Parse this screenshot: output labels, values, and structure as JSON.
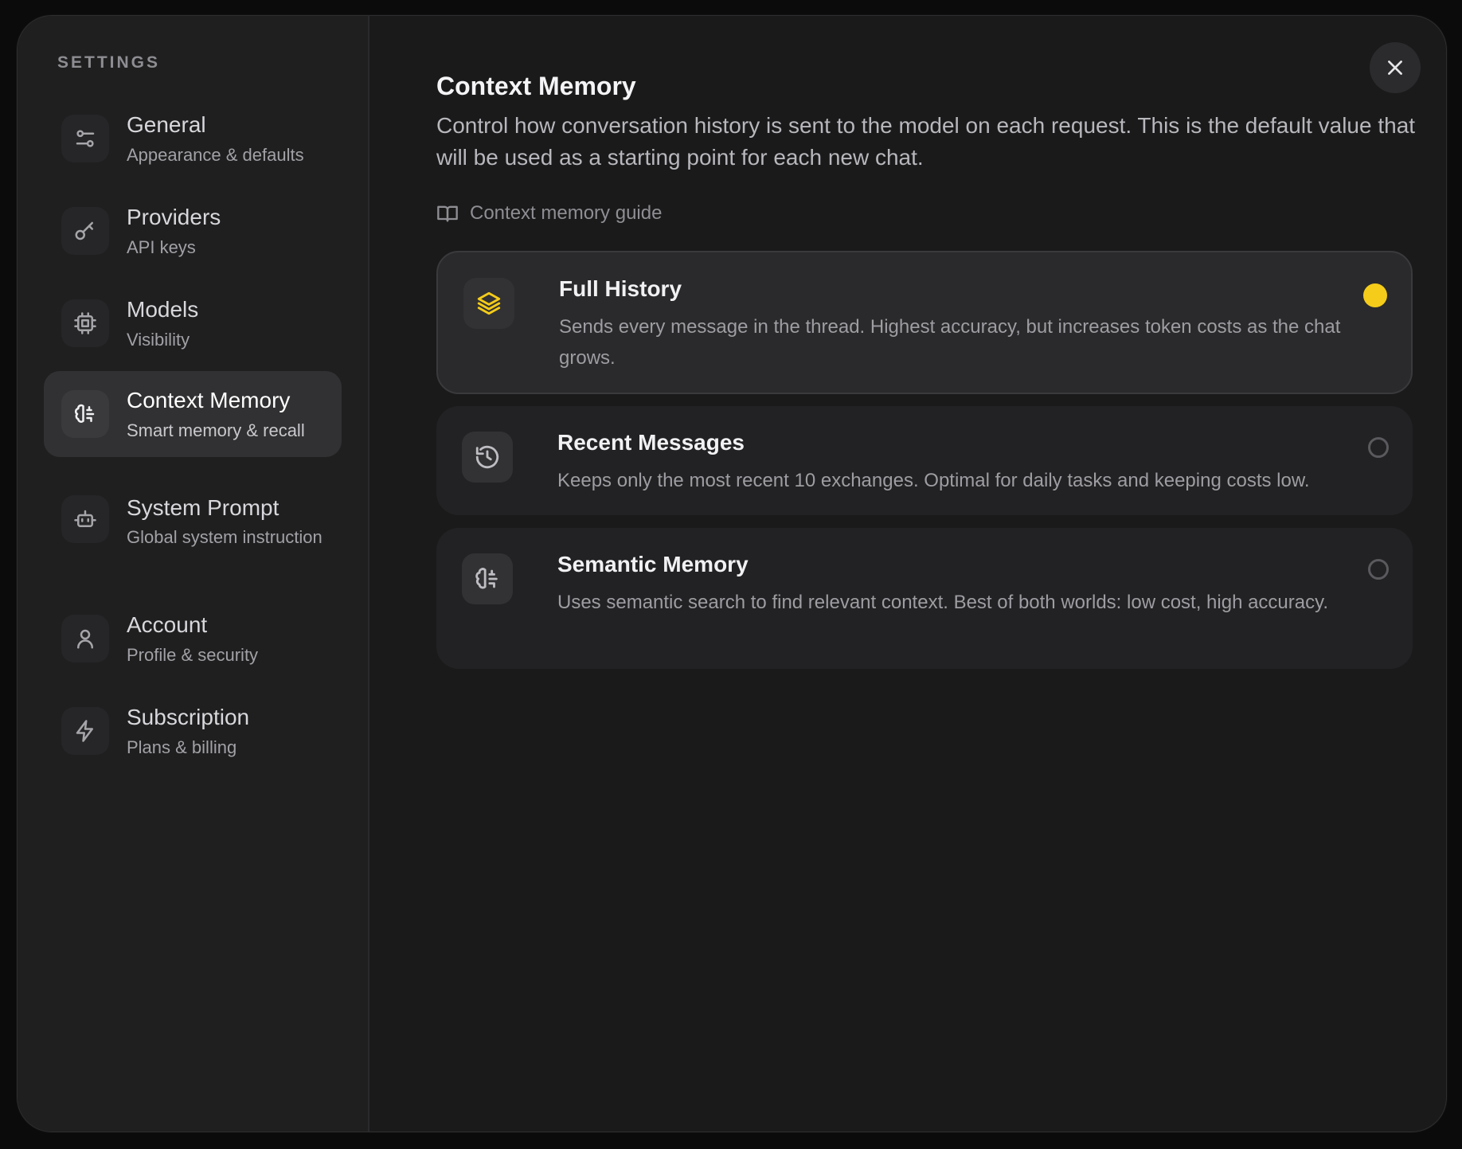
{
  "sidebar": {
    "title": "SETTINGS",
    "items": [
      {
        "label": "General",
        "sub": "Appearance & defaults",
        "icon": "sliders-icon"
      },
      {
        "label": "Providers",
        "sub": "API keys",
        "icon": "key-icon"
      },
      {
        "label": "Models",
        "sub": "Visibility",
        "icon": "cpu-icon"
      },
      {
        "label": "Context Memory",
        "sub": "Smart memory & recall",
        "icon": "brain-icon",
        "active": true
      },
      {
        "label": "System Prompt",
        "sub": "Global system instruction",
        "icon": "bot-icon"
      },
      {
        "label": "Account",
        "sub": "Profile & security",
        "icon": "user-icon"
      },
      {
        "label": "Subscription",
        "sub": "Plans & billing",
        "icon": "lightning-icon"
      }
    ]
  },
  "main": {
    "title": "Context Memory",
    "description": "Control how conversation history is sent to the model on each request. This is the default value that will be used as a starting point for each new chat.",
    "guide_link": "Context memory guide",
    "options": [
      {
        "title": "Full History",
        "description": "Sends every message in the thread. Highest accuracy, but increases token costs as the chat grows.",
        "icon": "layers-icon",
        "selected": true
      },
      {
        "title": "Recent Messages",
        "description": "Keeps only the most recent 10 exchanges. Optimal for daily tasks and keeping costs low.",
        "icon": "history-icon",
        "selected": false
      },
      {
        "title": "Semantic Memory",
        "description": "Uses semantic search to find relevant context. Best of both worlds: low cost, high accuracy.",
        "icon": "brain-icon",
        "selected": false
      }
    ]
  },
  "colors": {
    "accent": "#f5cc19",
    "background": "#1a1a1b",
    "sidebar": "#1f1f20"
  }
}
